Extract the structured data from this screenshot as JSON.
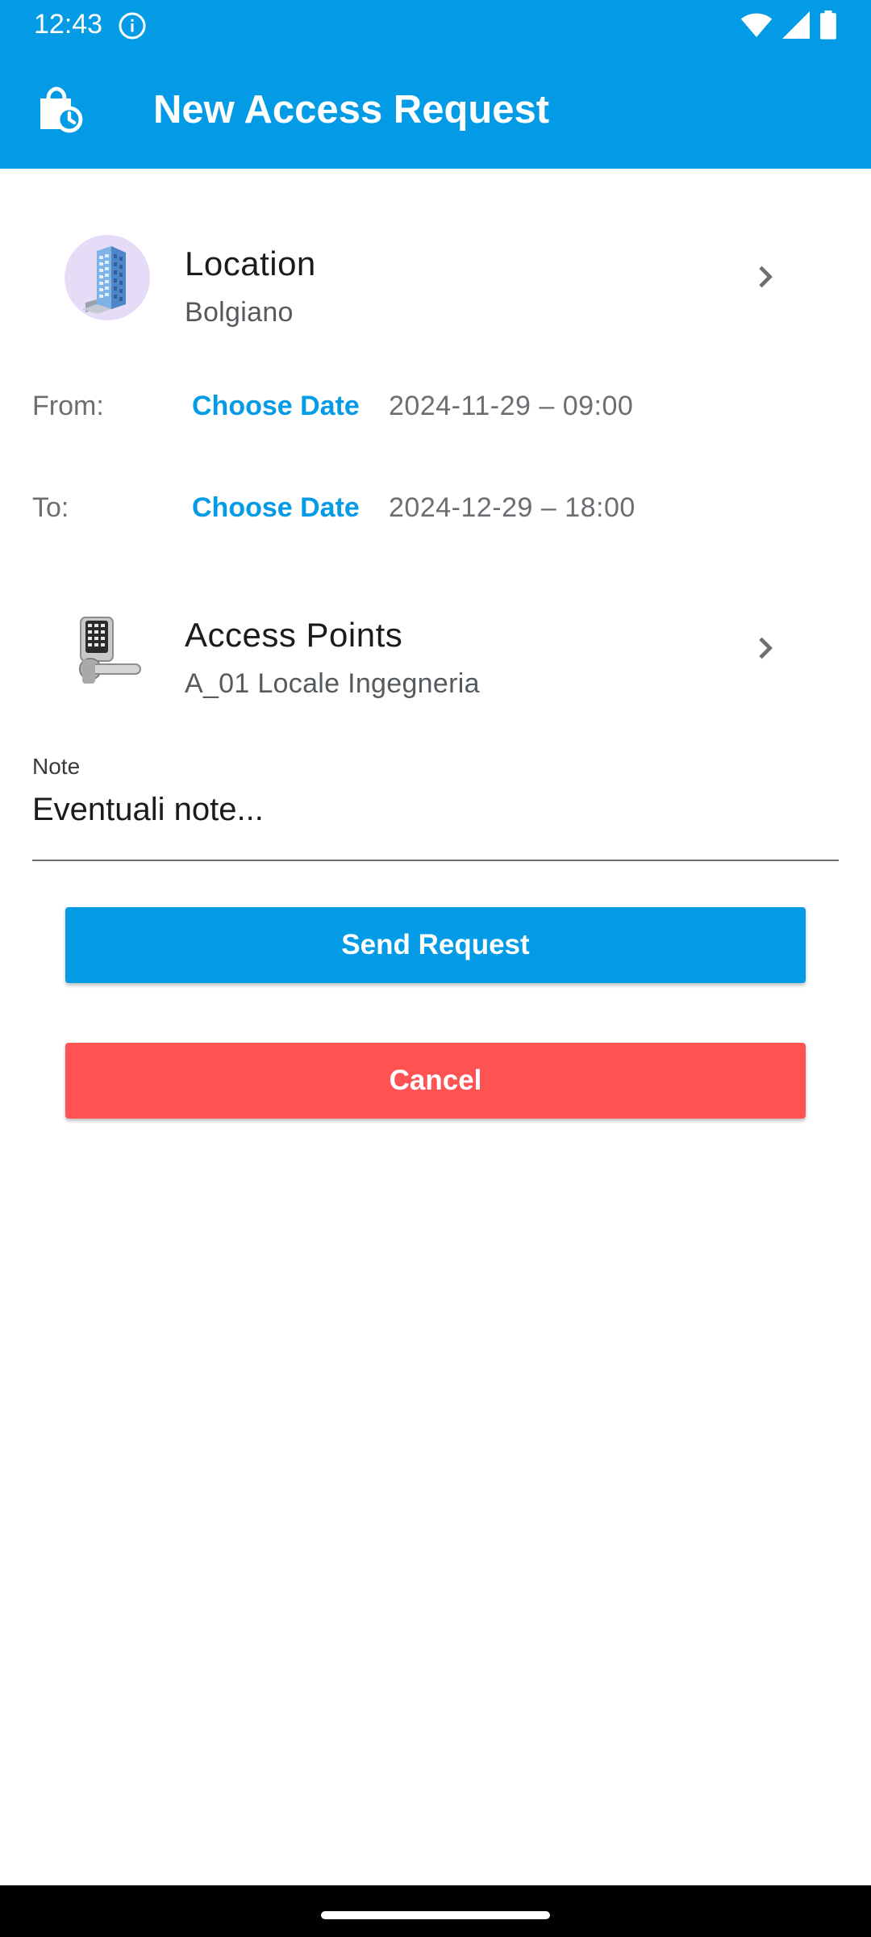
{
  "status_bar": {
    "time": "12:43",
    "icons": [
      "info-icon",
      "wifi-icon",
      "signal-icon",
      "battery-icon"
    ]
  },
  "app_bar": {
    "icon": "access-time-icon",
    "title": "New Access Request"
  },
  "location": {
    "title": "Location",
    "value": "Bolgiano",
    "icon": "building-icon"
  },
  "from": {
    "label": "From:",
    "button": "Choose Date",
    "value": "2024-11-29 – 09:00"
  },
  "to": {
    "label": "To:",
    "button": "Choose Date",
    "value": "2024-12-29 – 18:00"
  },
  "access_points": {
    "title": "Access Points",
    "value": "A_01 Locale Ingegneria",
    "icon": "keypad-lock-icon"
  },
  "note": {
    "label": "Note",
    "placeholder": "Eventuali note..."
  },
  "buttons": {
    "send": "Send Request",
    "cancel": "Cancel"
  },
  "colors": {
    "primary": "#039BE5",
    "danger": "#FF5252"
  }
}
